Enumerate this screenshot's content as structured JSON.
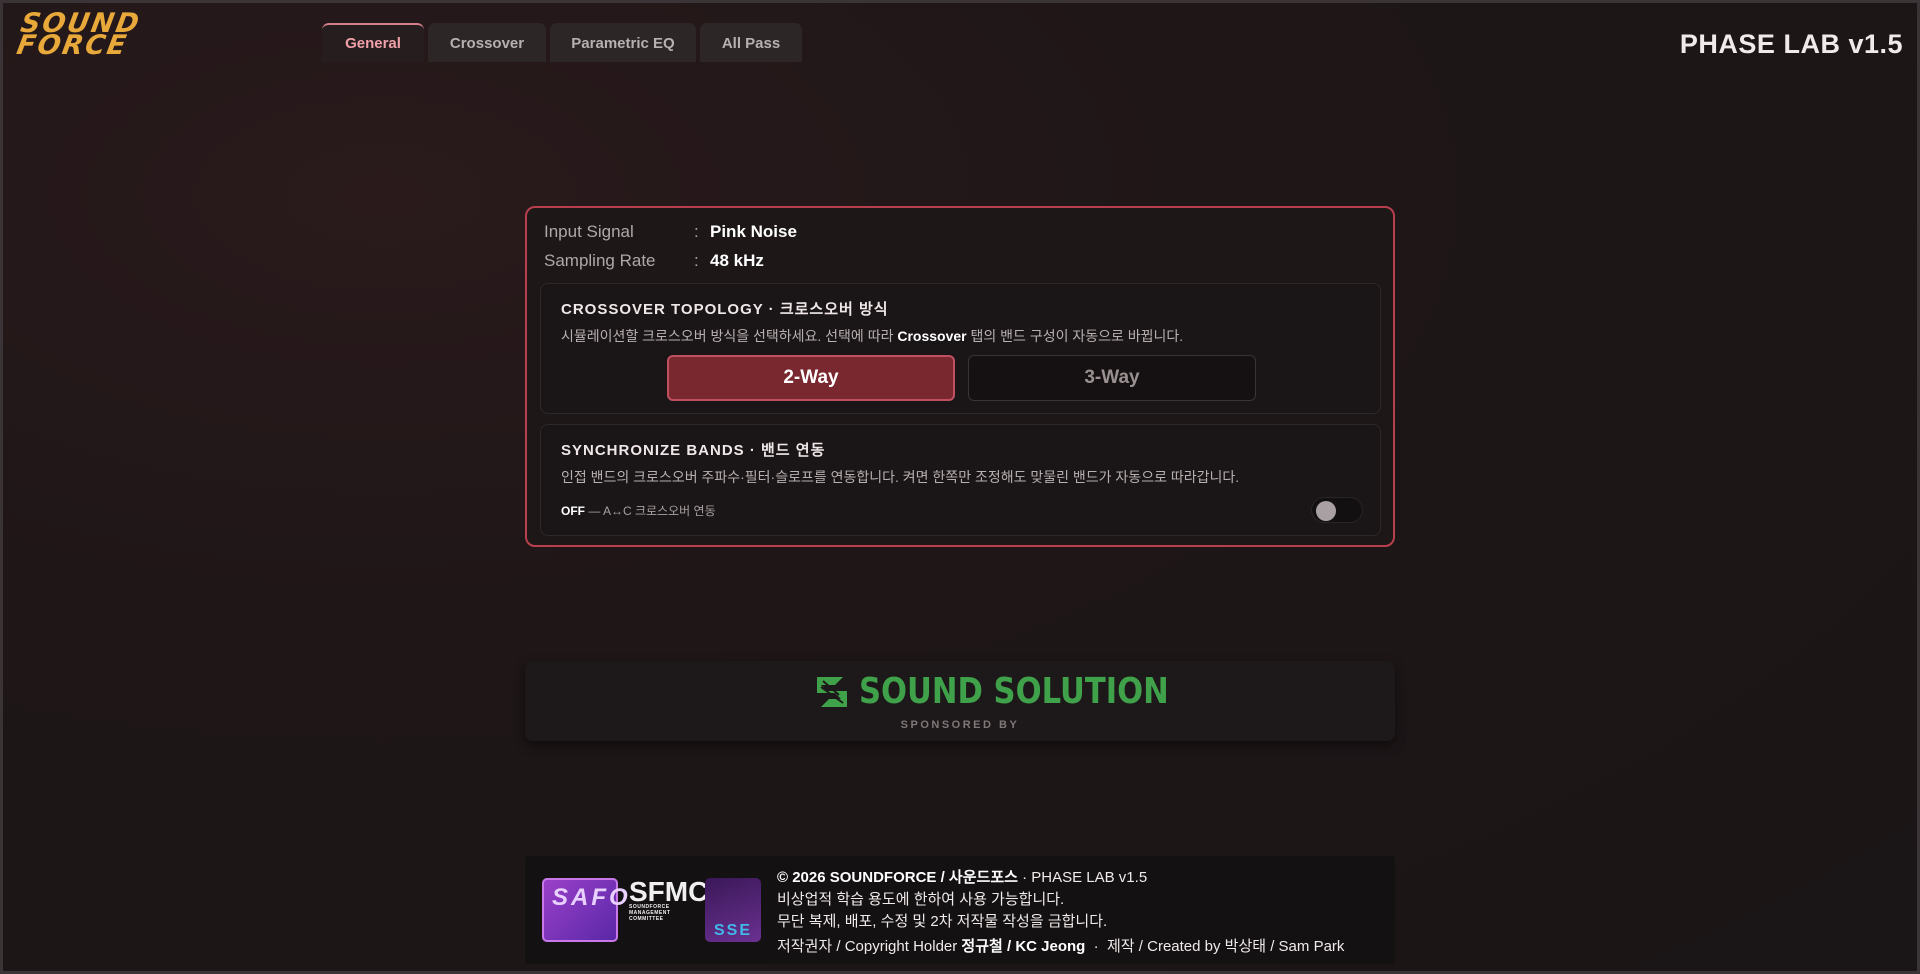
{
  "header": {
    "logo_line1": "SOUND",
    "logo_line2": "FORCE",
    "tabs": [
      {
        "label": "General"
      },
      {
        "label": "Crossover"
      },
      {
        "label": "Parametric EQ"
      },
      {
        "label": "All Pass"
      }
    ],
    "active_tab": "General",
    "app_title": "PHASE LAB v1.5"
  },
  "info": {
    "input_signal_label": "Input Signal",
    "input_signal_value": "Pink Noise",
    "sampling_rate_label": "Sampling Rate",
    "sampling_rate_value": "48 kHz",
    "separator": ":"
  },
  "topology": {
    "title": "CROSSOVER TOPOLOGY · 크로스오버 방식",
    "desc_before": "시뮬레이션할 크로스오버 방식을 선택하세요. 선택에 따라 ",
    "desc_bold": "Crossover",
    "desc_after": " 탭의 밴드 구성이 자동으로 바뀝니다.",
    "option_2way": "2-Way",
    "option_3way": "3-Way",
    "selected": "2-Way"
  },
  "sync": {
    "title": "SYNCHRONIZE BANDS · 밴드 연동",
    "desc": "인접 밴드의 크로스오버 주파수·필터·슬로프를 연동합니다. 켜면 한쪽만 조정해도 맞물린 밴드가 자동으로 따라갑니다.",
    "state": "OFF",
    "state_desc": " — A↔C 크로스오버 연동",
    "enabled": false
  },
  "sponsor": {
    "name": "SOUND SOLUTION",
    "by": "SPONSORED BY",
    "color": "#3fa24a"
  },
  "footer": {
    "badge_safo": "SAFO",
    "badge_sfmc": "SFMC",
    "badge_sfmc_small": "SOUNDFORCE MANAGEMENT COMMITTEE",
    "badge_sse": "SSE",
    "copyright_bold": "© 2026 SOUNDFORCE / 사운드포스",
    "copyright_rest": " · PHASE LAB v1.5",
    "line2": "비상업적 학습 용도에 한하여 사용 가능합니다.",
    "line3": "무단 복제, 배포, 수정 및 2차 저작물 작성을 금합니다.",
    "holder_label": "저작권자 / Copyright Holder ",
    "holder_name": "정규철 / KC Jeong",
    "creator": "  ·  제작 / Created by 박상태 / Sam Park"
  },
  "colors": {
    "accent": "#b8404e",
    "logo": "#e9a83a",
    "active_btn": "#7a2830"
  }
}
